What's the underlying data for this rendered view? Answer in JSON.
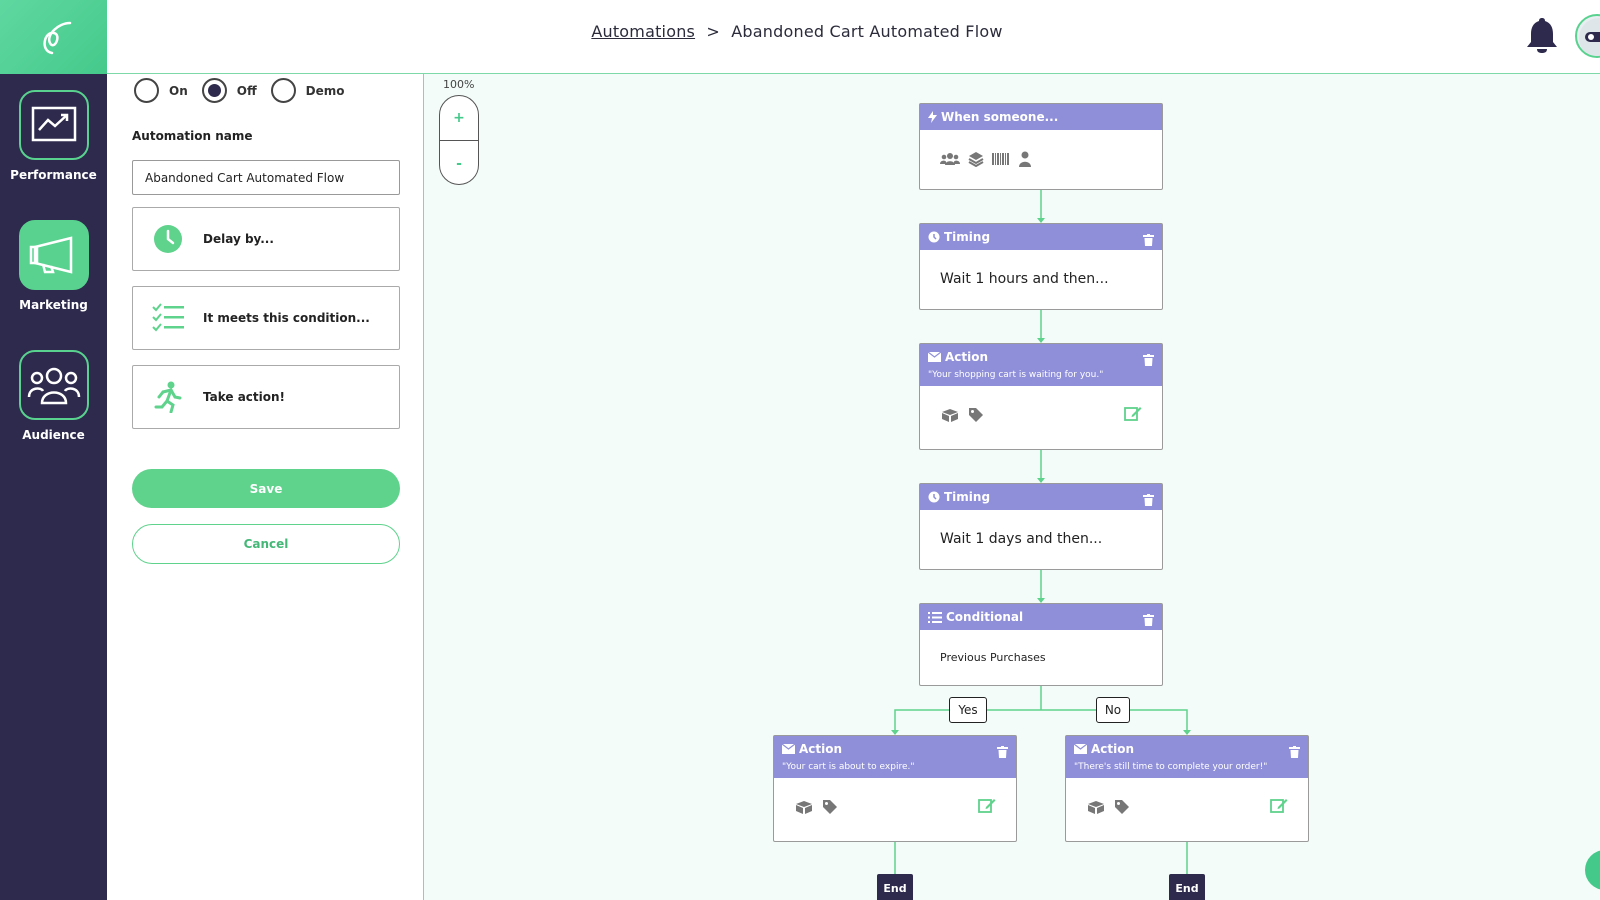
{
  "sidebar": {
    "items": [
      {
        "label": "Performance",
        "icon": "chart-line-icon"
      },
      {
        "label": "Marketing",
        "icon": "megaphone-icon"
      },
      {
        "label": "Audience",
        "icon": "users-icon"
      }
    ]
  },
  "header": {
    "breadcrumb_root": "Automations",
    "breadcrumb_separator": ">",
    "breadcrumb_current": "Abandoned Cart Automated Flow"
  },
  "panel": {
    "status_options": [
      {
        "label": "On",
        "selected": false
      },
      {
        "label": "Off",
        "selected": true
      },
      {
        "label": "Demo",
        "selected": false
      }
    ],
    "name_label": "Automation name",
    "name_value": "Abandoned Cart Automated Flow",
    "blocks": [
      {
        "label": "Delay by...",
        "icon": "clock-icon"
      },
      {
        "label": "It meets this condition...",
        "icon": "checklist-icon"
      },
      {
        "label": "Take action!",
        "icon": "running-person-icon"
      }
    ],
    "save_label": "Save",
    "cancel_label": "Cancel"
  },
  "canvas": {
    "zoom_level": "100%",
    "zoom_in": "+",
    "zoom_out": "-",
    "trigger": {
      "title": "When someone..."
    },
    "timing_1": {
      "title": "Timing",
      "text": "Wait 1 hours and then..."
    },
    "action_1": {
      "title": "Action",
      "subtitle": "\"Your shopping cart is waiting for you.\""
    },
    "timing_2": {
      "title": "Timing",
      "text": "Wait 1 days and then..."
    },
    "conditional": {
      "title": "Conditional",
      "text": "Previous Purchases"
    },
    "branch_yes": "Yes",
    "branch_no": "No",
    "action_yes": {
      "title": "Action",
      "subtitle": "\"Your cart is about to expire.\""
    },
    "action_no": {
      "title": "Action",
      "subtitle": "\"There's still time to complete your order!\""
    },
    "end_label": "End"
  },
  "colors": {
    "sidebar_bg": "#2e2a4d",
    "accent_green": "#5fd28c",
    "node_header": "#8f8fd9",
    "canvas_bg": "#f3fcf8"
  }
}
